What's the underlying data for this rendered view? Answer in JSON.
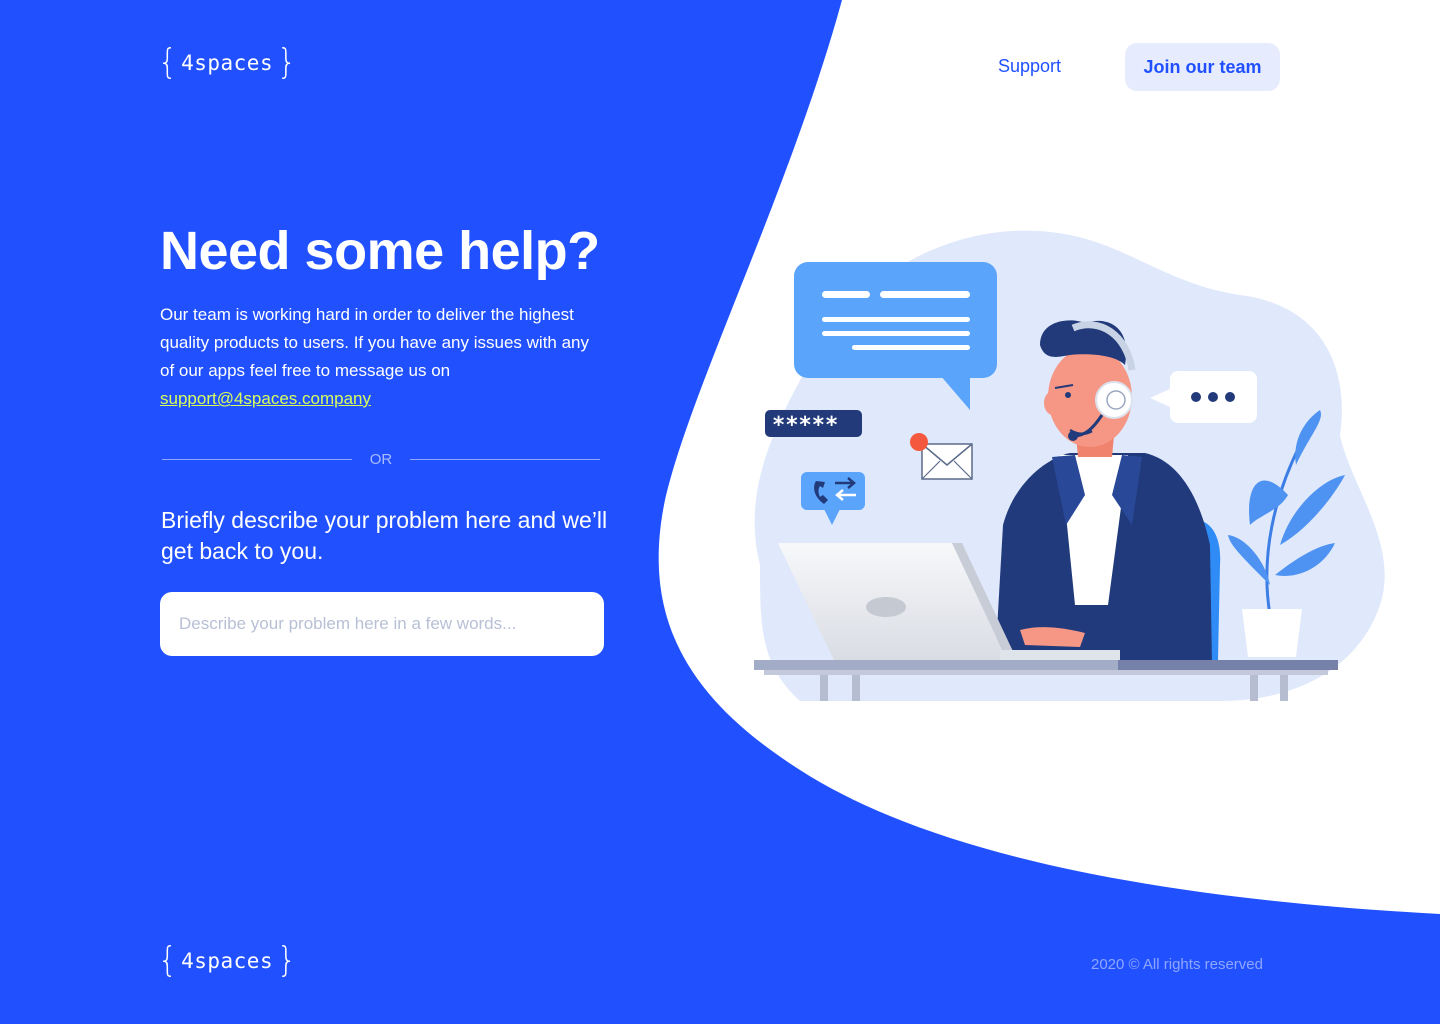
{
  "brand": {
    "name": "4spaces",
    "open_brace": "{",
    "close_brace": "}"
  },
  "nav": {
    "support_label": "Support",
    "join_label": "Join our team"
  },
  "hero": {
    "title": "Need some help?",
    "intro_text": "Our team is working hard in order to deliver the highest quality products to users. If you have any issues with any of our apps feel free to message us on",
    "email": "support@4spaces.company",
    "divider_label": "OR",
    "subheading": "Briefly describe your problem here and we’ll get back to you.",
    "input_placeholder": "Describe your problem here in a few words...",
    "input_value": ""
  },
  "illustration": {
    "password_mask": "*****",
    "chat_dots": "•••"
  },
  "footer": {
    "copyright": "2020 © All rights reserved"
  },
  "colors": {
    "primary": "#2151ff",
    "white": "#ffffff",
    "link_highlight": "#d8ff5a",
    "button_bg": "#e6ecfe"
  },
  "icons": [
    "open-brace-icon",
    "close-brace-icon",
    "chat-bubble-icon",
    "password-badge-icon",
    "envelope-icon",
    "phone-transfer-icon",
    "ellipsis-bubble-icon",
    "headset-icon",
    "plant-icon",
    "laptop-icon"
  ]
}
